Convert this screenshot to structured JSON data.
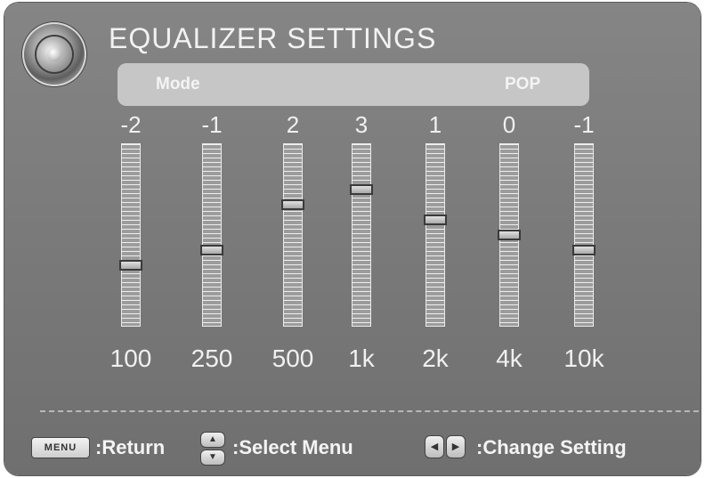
{
  "title": "EQUALIZER SETTINGS",
  "mode": {
    "label": "Mode",
    "value": "POP"
  },
  "bands": [
    {
      "freq": "100",
      "value": "-2",
      "level": -2
    },
    {
      "freq": "250",
      "value": "-1",
      "level": -1
    },
    {
      "freq": "500",
      "value": "2",
      "level": 2
    },
    {
      "freq": "1k",
      "value": "3",
      "level": 3
    },
    {
      "freq": "2k",
      "value": "1",
      "level": 1
    },
    {
      "freq": "4k",
      "value": "0",
      "level": 0
    },
    {
      "freq": "10k",
      "value": "-1",
      "level": -1
    }
  ],
  "footer": {
    "menu_key": "MENU",
    "return_label": ":Return",
    "select_label": ":Select Menu",
    "change_label": ":Change Setting",
    "updown_icon": "up-down-arrow-keys-icon",
    "leftright_icon": "left-right-arrow-keys-icon"
  },
  "colors": {
    "panel": "#7c7c7c",
    "mode_bar": "#c6c6c6",
    "text": "#f2f2f2"
  }
}
